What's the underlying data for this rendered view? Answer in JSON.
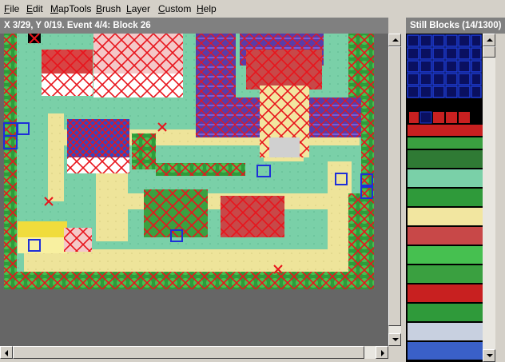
{
  "menu": [
    {
      "label": "File",
      "key": "F"
    },
    {
      "label": "Edit",
      "key": "E"
    },
    {
      "label": "MapTools",
      "key": "M"
    },
    {
      "label": "Brush",
      "key": "B"
    },
    {
      "label": "Layer",
      "key": "L"
    },
    {
      "label": "Custom",
      "key": "C"
    },
    {
      "label": "Help",
      "key": "H"
    }
  ],
  "map_panel": {
    "status": "X 3/29, Y 0/19. Event 4/4: Block 26"
  },
  "tile_panel": {
    "title": "Still Blocks (14/1300)"
  },
  "icons": {
    "scroll_up": "arrow-up-icon",
    "scroll_down": "arrow-down-icon",
    "scroll_left": "arrow-left-icon",
    "scroll_right": "arrow-right-icon"
  }
}
